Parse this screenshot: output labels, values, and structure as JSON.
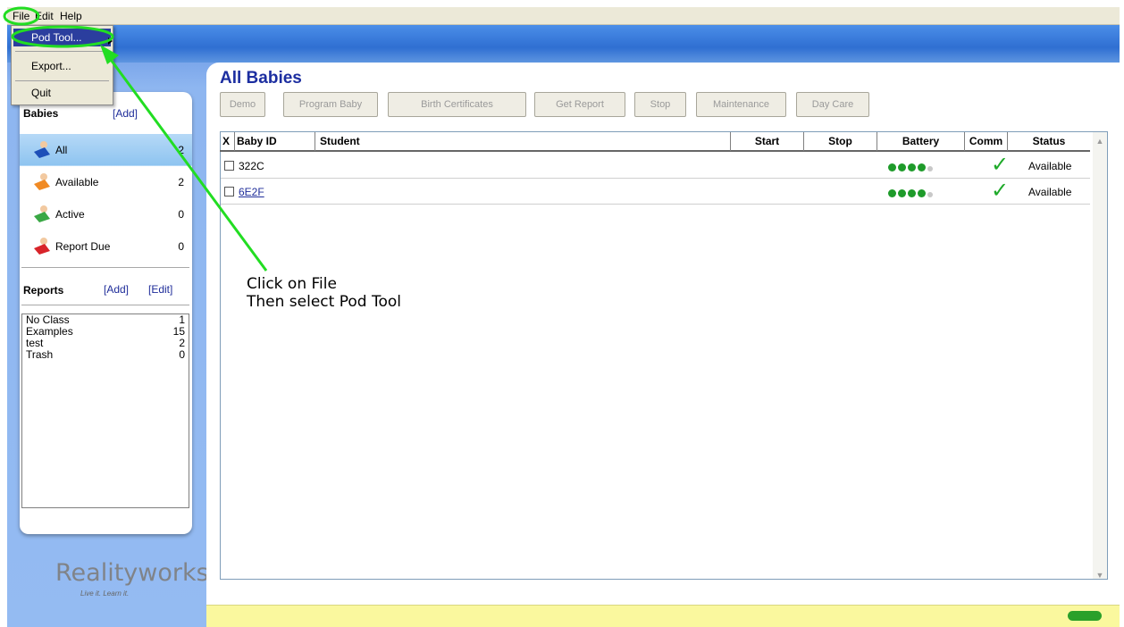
{
  "menubar": {
    "file": "File",
    "edit": "Edit",
    "help": "Help"
  },
  "file_menu": {
    "pod_tool": "Pod Tool...",
    "export": "Export...",
    "quit": "Quit"
  },
  "babies": {
    "header": "Babies",
    "add_link": "[Add]",
    "items": [
      {
        "label": "All",
        "count": "2",
        "icon": "baby-blue-icon"
      },
      {
        "label": "Available",
        "count": "2",
        "icon": "baby-orange-icon"
      },
      {
        "label": "Active",
        "count": "0",
        "icon": "baby-green-icon"
      },
      {
        "label": "Report Due",
        "count": "0",
        "icon": "baby-red-icon"
      }
    ]
  },
  "reports": {
    "header": "Reports",
    "add_link": "[Add]",
    "edit_link": "[Edit]",
    "items": [
      {
        "label": "No Class",
        "count": "1"
      },
      {
        "label": "Examples",
        "count": "15"
      },
      {
        "label": "test",
        "count": "2"
      },
      {
        "label": "Trash",
        "count": "0"
      }
    ]
  },
  "logo": {
    "brand": "Realityworks",
    "tagline": "Live it. Learn it."
  },
  "main": {
    "title": "All Babies",
    "toolbar": [
      "Demo",
      "Program Baby",
      "Birth Certificates",
      "Get Report",
      "Stop",
      "Maintenance",
      "Day Care"
    ]
  },
  "table": {
    "headers": {
      "x": "X",
      "baby_id": "Baby ID",
      "student": "Student",
      "start": "Start",
      "stop": "Stop",
      "battery": "Battery",
      "comm": "Comm",
      "status": "Status"
    },
    "rows": [
      {
        "baby_id": "322C",
        "student": "",
        "start": "",
        "stop": "",
        "battery_level": 4,
        "battery_max": 5,
        "comm": "ok",
        "status": "Available"
      },
      {
        "baby_id": "6E2F",
        "student": "",
        "start": "",
        "stop": "",
        "battery_level": 4,
        "battery_max": 5,
        "comm": "ok",
        "status": "Available"
      }
    ]
  },
  "annotation": {
    "line1": "Click on File",
    "line2": "Then select Pod Tool"
  },
  "colors": {
    "title": "#1c2ea0",
    "highlight": "#2b3e9e",
    "annotation_green": "#22dd22",
    "status_bar": "#faf89e",
    "check_green": "#1faa2a"
  }
}
